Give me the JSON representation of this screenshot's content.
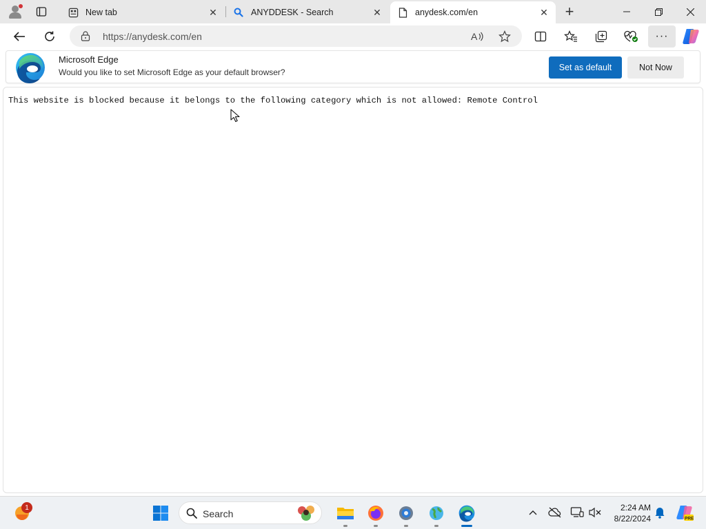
{
  "tabs": [
    {
      "title": "New tab",
      "icon": "new-tab-page-icon"
    },
    {
      "title": "ANYDDESK - Search",
      "icon": "search-favicon-icon"
    },
    {
      "title": "anydesk.com/en",
      "icon": "page-icon",
      "active": true
    }
  ],
  "address_bar": {
    "url": "https://anydesk.com/en"
  },
  "infobar": {
    "title": "Microsoft Edge",
    "message": "Would you like to set Microsoft Edge as your default browser?",
    "primary_button": "Set as default",
    "secondary_button": "Not Now"
  },
  "page": {
    "message": "This website is blocked because it belongs to the following category which is not allowed: Remote Control"
  },
  "taskbar": {
    "search_label": "Search",
    "weather_badge": "1",
    "time": "2:24 AM",
    "date": "8/22/2024"
  },
  "colors": {
    "accent": "#0f6cbd",
    "taskbar": "#eef1f4",
    "tabstrip": "#e8e8e8"
  }
}
